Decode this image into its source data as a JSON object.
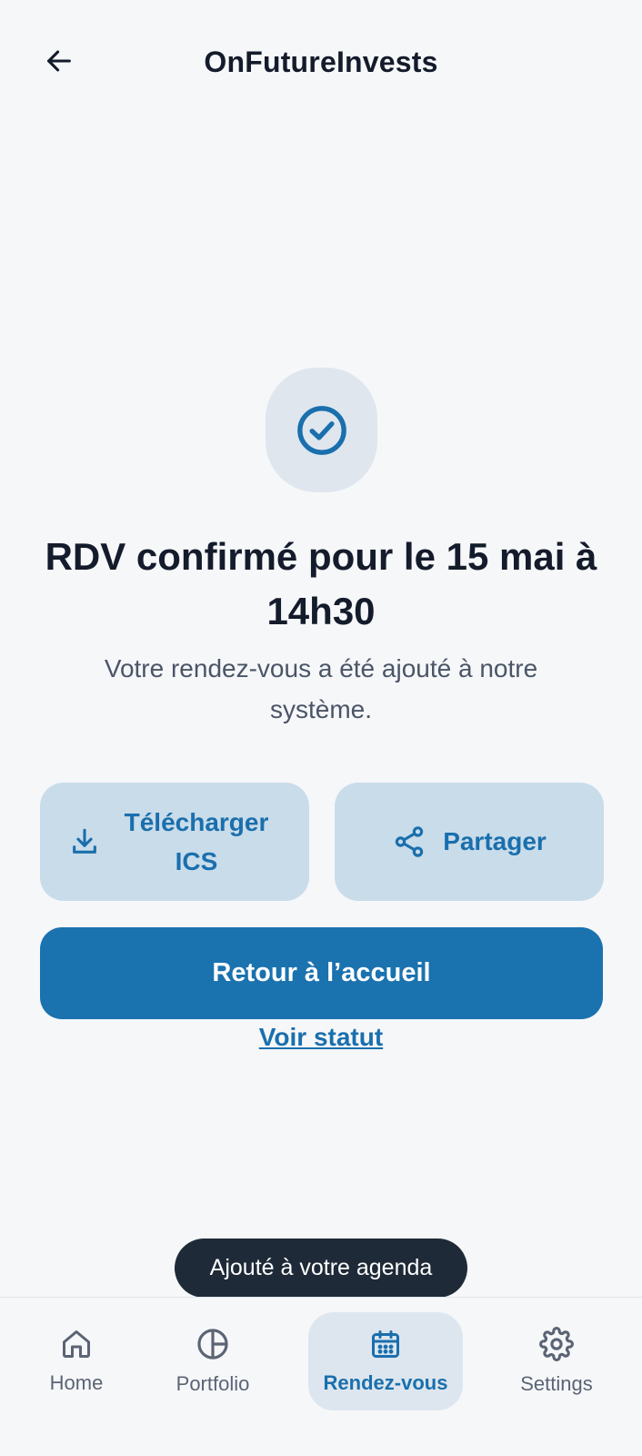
{
  "header": {
    "title": "OnFutureInvests",
    "back_icon": "arrow-left-icon"
  },
  "confirmation": {
    "icon": "check-circle-icon",
    "title": "RDV confirmé pour le 15 mai à 14h30",
    "subtitle": "Votre rendez-vous a été ajouté à notre système."
  },
  "actions": {
    "download_label": "Télécharger ICS",
    "download_icon": "download-icon",
    "share_label": "Partager",
    "share_icon": "share-icon",
    "home_label": "Retour à l’accueil",
    "status_link": "Voir statut"
  },
  "toast": {
    "message": "Ajouté à votre agenda"
  },
  "bottom_nav": {
    "items": [
      {
        "label": "Home",
        "icon": "home-icon",
        "active": false
      },
      {
        "label": "Portfolio",
        "icon": "pie-chart-icon",
        "active": false
      },
      {
        "label": "Rendez-vous",
        "icon": "calendar-icon",
        "active": true
      },
      {
        "label": "Settings",
        "icon": "gear-icon",
        "active": false
      }
    ]
  },
  "colors": {
    "background": "#f6f7f9",
    "primary": "#1a72af",
    "secondary_bg": "#c9dcea",
    "text_dark": "#141b2b",
    "toast_bg": "#1f2a38"
  }
}
